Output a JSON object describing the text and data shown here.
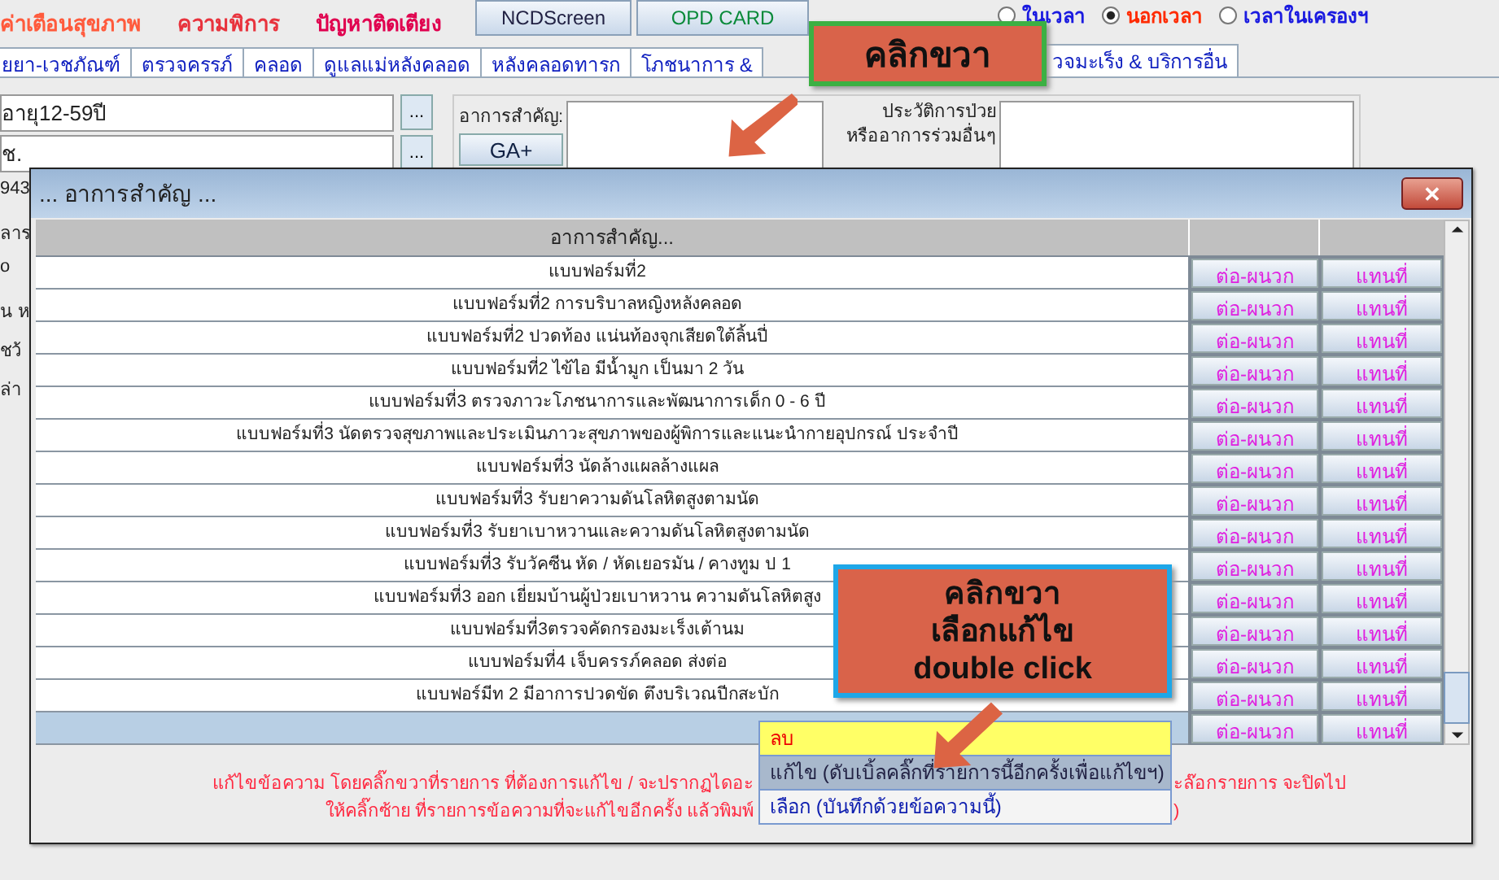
{
  "top_bar": {
    "labels": [
      {
        "text": "ค่าเตือนสุขภาพ",
        "color": "#ff5a3c"
      },
      {
        "text": "ความพิการ",
        "color": "#e8333d"
      },
      {
        "text": "ปัญหาติดเตียง",
        "color": "#e0004f"
      }
    ],
    "buttons": [
      {
        "label": "NCDScreen",
        "selected": false
      },
      {
        "label": "OPD CARD",
        "selected": true
      }
    ],
    "radios": [
      {
        "label": "ในเวลา",
        "selected": false
      },
      {
        "label": "นอกเวลา",
        "selected": true
      },
      {
        "label": "เวลาในเครองฯ",
        "selected": false
      }
    ]
  },
  "tabs": [
    {
      "label": "ยยา-เวชภัณฑ์",
      "selected": false
    },
    {
      "label": "ตรวจครรภ์",
      "selected": false
    },
    {
      "label": "คลอด",
      "selected": false
    },
    {
      "label": "ดูแลแม่หลังคลอด",
      "selected": false
    },
    {
      "label": "หลังคลอดทารก",
      "selected": false
    },
    {
      "label": "โภชนาการ &",
      "selected": false
    },
    {
      "label": "วจมะเร็ง & บริการอื่น",
      "selected": true
    }
  ],
  "left_fields": [
    {
      "value": "อายุ12-59ปี",
      "button": "..."
    },
    {
      "value": "ช.",
      "button": "..."
    }
  ],
  "left_fragments": [
    "943",
    "ลาร",
    "o",
    "น ห",
    "ชว้",
    "ล่า"
  ],
  "symptom_label": "อาการสำคัญ:",
  "ga_button": "GA+",
  "history_label": [
    "ประวัติการป่วย",
    "หรืออาการร่วมอื่นๆ"
  ],
  "dialog": {
    "title": "... อาการสำคัญ ...",
    "close": "✕",
    "column": "อาการสำคัญ...",
    "rows": [
      {
        "text": "แบบฟอร์มที่2",
        "append": "ต่อ-ผนวก",
        "replace": "แทนที่",
        "selected": false
      },
      {
        "text": "แบบฟอร์มที่2 การบริบาลหญิงหลังคลอด",
        "append": "ต่อ-ผนวก",
        "replace": "แทนที่",
        "selected": false
      },
      {
        "text": "แบบฟอร์มที่2 ปวดท้อง แน่นท้องจุกเสียดใต้ลิ้นปี่",
        "append": "ต่อ-ผนวก",
        "replace": "แทนที่",
        "selected": false
      },
      {
        "text": "แบบฟอร์มที่2 ไข้ไอ มีน้ำมูก เป็นมา 2 วัน",
        "append": "ต่อ-ผนวก",
        "replace": "แทนที่",
        "selected": false
      },
      {
        "text": "แบบฟอร์มที่3 ตรวจภาวะโภชนาการและพัฒนาการเด็ก 0 - 6 ปี",
        "append": "ต่อ-ผนวก",
        "replace": "แทนที่",
        "selected": false
      },
      {
        "text": "แบบฟอร์มที่3 นัดตรวจสุขภาพและประเมินภาวะสุขภาพของผู้พิการและแนะนำกายอุปกรณ์ ประจำปี",
        "append": "ต่อ-ผนวก",
        "replace": "แทนที่",
        "selected": false
      },
      {
        "text": "แบบฟอร์มที่3 นัดล้างแผลล้างแผล",
        "append": "ต่อ-ผนวก",
        "replace": "แทนที่",
        "selected": false
      },
      {
        "text": "แบบฟอร์มที่3 รับยาความดันโลหิตสูงตามนัด",
        "append": "ต่อ-ผนวก",
        "replace": "แทนที่",
        "selected": false
      },
      {
        "text": "แบบฟอร์มที่3 รับยาเบาหวานและความดันโลหิตสูงตามนัด",
        "append": "ต่อ-ผนวก",
        "replace": "แทนที่",
        "selected": false
      },
      {
        "text": "แบบฟอร์มที่3 รับวัคซีน หัด / หัดเยอรมัน / คางทูม ป 1",
        "append": "ต่อ-ผนวก",
        "replace": "แทนที่",
        "selected": false
      },
      {
        "text": "แบบฟอร์มที่3 ออก เยี่ยมบ้านผู้ป่วยเบาหวาน ความดันโลหิตสูง",
        "append": "ต่อ-ผนวก",
        "replace": "แทนที่",
        "selected": false
      },
      {
        "text": "แบบฟอร์มที่3ตรวจคัดกรองมะเร็งเต้านม",
        "append": "ต่อ-ผนวก",
        "replace": "แทนที่",
        "selected": false
      },
      {
        "text": "แบบฟอร์มที่4  เจ็บครรภ์คลอด ส่งต่อ",
        "append": "ต่อ-ผนวก",
        "replace": "แทนที่",
        "selected": false
      },
      {
        "text": "แบบฟอร์มีท 2 มีอาการปวดขัด ตึงบริเวณปีกสะบัก",
        "append": "ต่อ-ผนวก",
        "replace": "แทนที่",
        "selected": false
      },
      {
        "text": "",
        "append": "ต่อ-ผนวก",
        "replace": "แทนที่",
        "selected": true
      }
    ],
    "note": [
      {
        "left": "แก้ไขข้อความ โดยคลิ๊กขวาที่รายการ ที่ต้องการแก้ไข / จะปรากฏไดอะ",
        "right": "ะล๊อกรายการ จะปิดไป"
      },
      {
        "left": "ให้คลิ๊กซ้าย ที่รายการข้อความที่จะแก้ไขอีกครั้ง แล้วพิมพ์",
        "right": ")"
      }
    ]
  },
  "context_menu": [
    {
      "label": "ลบ",
      "kind": "delete",
      "selected": false
    },
    {
      "label": "แก้ไข (ดับเบิ้ลคลิ๊กที่รายการนี้อีกครั้งเพื่อแก้ไขฯ)",
      "kind": "edit",
      "selected": true
    },
    {
      "label": "เลือก (บันทึกด้วยข้อความนี้)",
      "kind": "choose",
      "selected": false
    }
  ],
  "callouts": [
    {
      "lines": [
        "คลิกขวา"
      ],
      "color": "#3cb043"
    },
    {
      "lines": [
        "คลิกขวา",
        "เลือกแก้ไข",
        "double click"
      ],
      "color": "#1ea7e8"
    }
  ]
}
